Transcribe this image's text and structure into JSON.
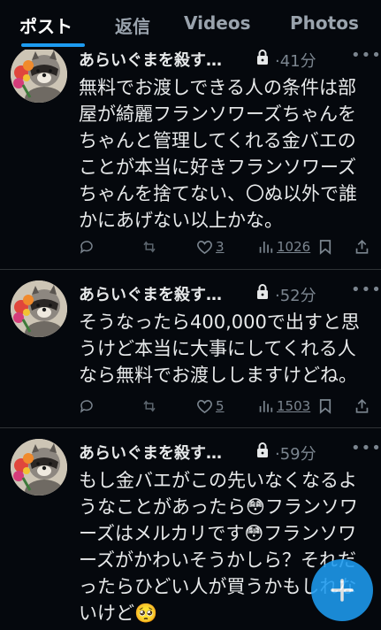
{
  "tabs": [
    {
      "label": "ポスト",
      "active": true
    },
    {
      "label": "返信",
      "active": false
    },
    {
      "label": "Videos",
      "active": false
    },
    {
      "label": "Photos",
      "active": false
    }
  ],
  "colors": {
    "background": "#05080d",
    "accent": "#1d9bf0",
    "text": "#e7e9ea",
    "muted": "#7b858f"
  },
  "posts": [
    {
      "author": "あらいぐまを殺す…",
      "locked": true,
      "time": "41分",
      "lines": [
        "無料でお渡しできる人の条件は部",
        "屋が綺麗フランソワーズちゃんを",
        "ちゃんと管理してくれる金バエの",
        "ことが本当に好きフランソワーズ",
        "ちゃんを捨てない、〇ぬ以外で誰",
        "かにあげない以上かな。"
      ],
      "likes": "3",
      "views": "1026"
    },
    {
      "author": "あらいぐまを殺す…",
      "locked": true,
      "time": "52分",
      "lines": [
        "そうなったら400,000で出すと思",
        "うけど本当に大事にしてくれる人",
        "なら無料でお渡ししますけどね。"
      ],
      "likes": "5",
      "views": "1503"
    },
    {
      "author": "あらいぐまを殺す…",
      "locked": true,
      "time": "59分",
      "lines": [
        "もし金バエがこの先いなくなるよ",
        "うなことがあったら😳フランソワ",
        "ーズはメルカリです😳フランソワ",
        "ーズがかわいそうかしら？それだ",
        "ったらひどい人が買うかもしれな",
        "いけど🥺"
      ]
    }
  ],
  "icons": {
    "reply": "reply-icon",
    "repost": "repost-icon",
    "like": "heart-icon",
    "views": "views-icon",
    "bookmark": "bookmark-icon",
    "share": "share-icon",
    "lock": "lock-icon",
    "more": "more-icon",
    "compose": "plus-icon"
  }
}
